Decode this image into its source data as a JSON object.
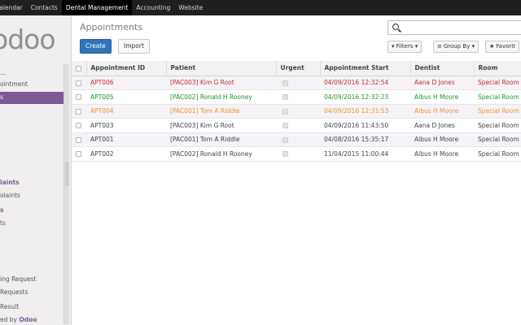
{
  "topnav": {
    "tabs": [
      "Calendar",
      "Contacts",
      "Dental Management",
      "Accounting",
      "Website"
    ],
    "active_tab": "Dental Management"
  },
  "sidebar": {
    "logo": "odoo",
    "items": [
      "...",
      "ointment",
      "s",
      "laints",
      "olaints",
      "s",
      "ts",
      "ing Request",
      "Requests",
      "Result"
    ],
    "powered_prefix": "ed by ",
    "powered_brand": "Odoo"
  },
  "main": {
    "breadcrumb": "Appointments",
    "create_label": "Create",
    "import_label": "Import",
    "search_placeholder": "",
    "filters_label": "Filters",
    "groupby_label": "Group By",
    "favorites_label": "Favorit"
  },
  "table": {
    "headers": [
      "Appointment ID",
      "Patient",
      "Urgent",
      "Appointment Start",
      "Dentist",
      "Room"
    ],
    "rows": [
      {
        "id": "APT006",
        "patient": "[PAC003] Kim G Root",
        "start": "04/09/2016 12:32:54",
        "dentist": "Aana D Jones",
        "room": "Special Room",
        "color": "red"
      },
      {
        "id": "APT005",
        "patient": "[PAC002] Ronald H Rooney",
        "start": "04/09/2016 12:32:23",
        "dentist": "Albus H Moore",
        "room": "Special Room",
        "color": "green"
      },
      {
        "id": "APT004",
        "patient": "[PAC001] Tom A Riddle",
        "start": "04/09/2016 12:31:53",
        "dentist": "Albus H Moore",
        "room": "Special Room",
        "color": "orange"
      },
      {
        "id": "APT003",
        "patient": "[PAC003] Kim G Root",
        "start": "04/09/2016 11:43:50",
        "dentist": "Aana D Jones",
        "room": "Special Room",
        "color": "gray"
      },
      {
        "id": "APT001",
        "patient": "[PAC001] Tom A Riddle",
        "start": "04/08/2016 15:35:17",
        "dentist": "Albus H Moore",
        "room": "Special Room",
        "color": "gray"
      },
      {
        "id": "APT002",
        "patient": "[PAC002] Ronald H Rooney",
        "start": "11/04/2015 11:00:44",
        "dentist": "Albus H Moore",
        "room": "Special Room",
        "color": "gray"
      }
    ]
  },
  "colors": {
    "accent": "#7c5a93",
    "primary_button": "#2f73b8",
    "topbar": "#1f1f1f",
    "status_red": "#c22e2e",
    "status_green": "#23922f",
    "status_orange": "#e8962a"
  }
}
